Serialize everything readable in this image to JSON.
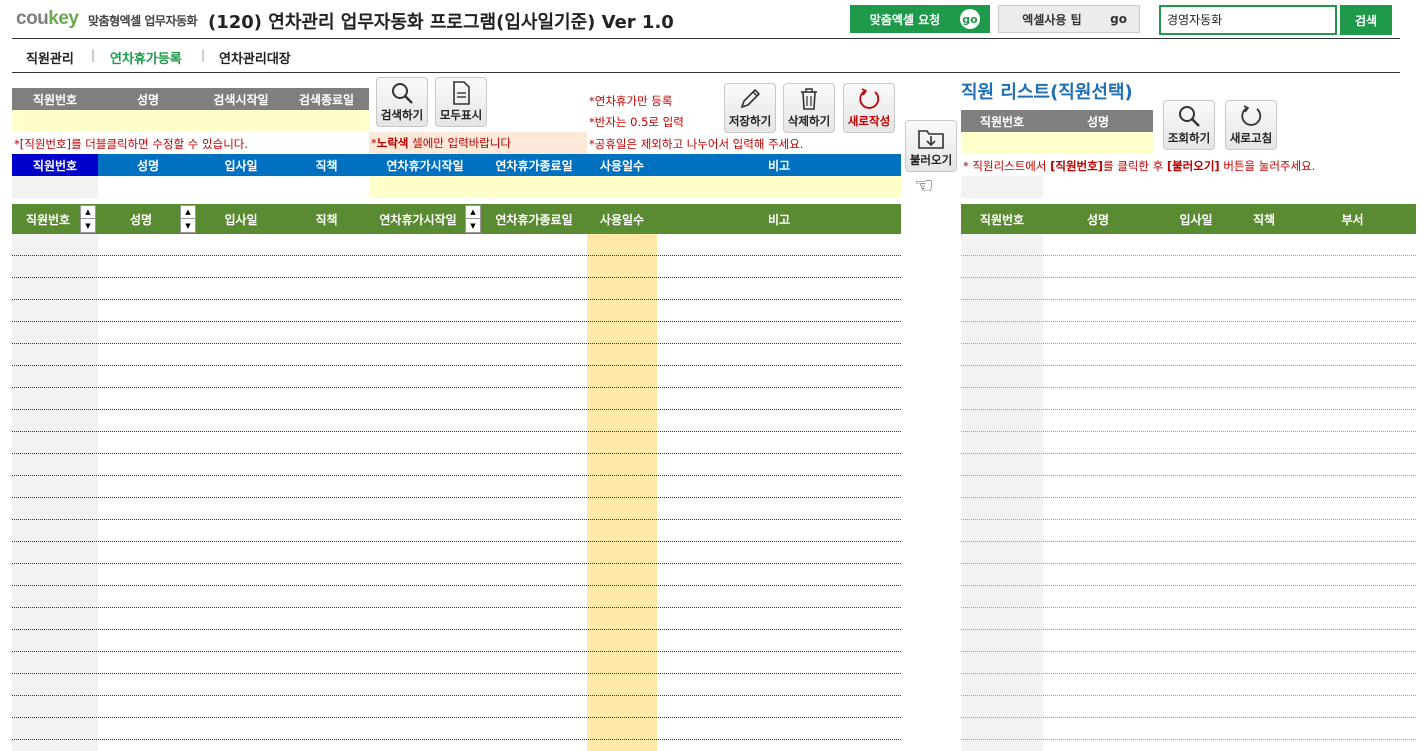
{
  "header": {
    "logo_co": "cou",
    "logo_key": "key",
    "logo_sub": "맞춤형엑셀 업무자동화",
    "title": "(120) 연차관리 업무자동화 프로그램(입사일기준) Ver 1.0",
    "btn_custom": "맞춤엑셀 요청",
    "btn_tips": "엑셀사용 팁",
    "go": "go",
    "search_value": "경영자동화",
    "search_button": "검색"
  },
  "nav": {
    "items": [
      "직원관리",
      "연차휴가등록",
      "연차관리대장"
    ],
    "active_color": "#1f9a4a"
  },
  "search_panel": {
    "headers": [
      "직원번호",
      "성명",
      "검색시작일",
      "검색종료일"
    ],
    "btn_search": "검색하기",
    "btn_showall": "모두표시",
    "note1": "*[직원번호]를 더블클릭하면 수정할 수 있습니다.",
    "note2_pre": "*",
    "note2_bold": "노락색",
    "note2_post": " 셀에만 입력바랍니다"
  },
  "notes_mid": [
    "*연차휴가만 등록",
    "*반자는 0.5로 입력",
    "*공휴일은 제외하고 나누어서 입력해 주세요."
  ],
  "actions": {
    "save": "저장하기",
    "delete": "삭제하기",
    "new": "새로작성",
    "load": "불러오기"
  },
  "entry_headers": [
    "직원번호",
    "성명",
    "입사일",
    "직책",
    "연차휴가시작일",
    "연차휴가종료일",
    "사용일수",
    "비고"
  ],
  "list_headers": [
    "직원번호",
    "성명",
    "입사일",
    "직책",
    "연차휴가시작일",
    "연차휴가종료일",
    "사용일수",
    "비고"
  ],
  "right": {
    "title": "직원 리스트(직원선택)",
    "filter_headers": [
      "직원번호",
      "성명"
    ],
    "btn_query": "조회하기",
    "btn_refresh": "새로고침",
    "note_pre": "* 직원리스트에서 ",
    "note_b1": "[직원번호]",
    "note_mid": "를 클릭한 후 ",
    "note_b2": "[불러오기]",
    "note_post": " 버튼을 눌러주세요.",
    "list_headers": [
      "직원번호",
      "성명",
      "입사일",
      "직책",
      "부서"
    ]
  },
  "colors": {
    "green": "#1f9a4a",
    "list_header_green": "#5a8a32",
    "entry_blue": "#0070c0",
    "yellow_input": "#ffffcc",
    "days_column": "#ffe8a8"
  }
}
